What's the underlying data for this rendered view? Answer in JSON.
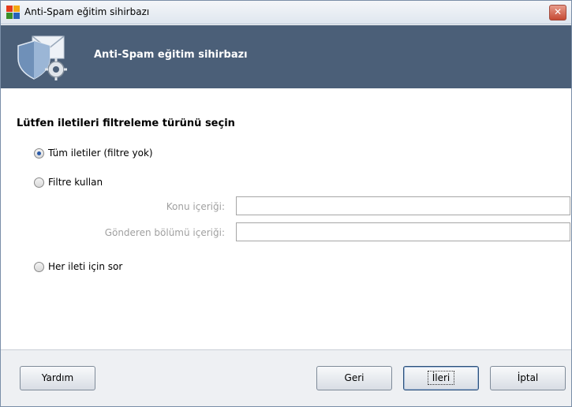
{
  "window": {
    "title": "Anti-Spam eğitim sihirbazı",
    "close_label": "✕"
  },
  "banner": {
    "title": "Anti-Spam eğitim sihirbazı"
  },
  "form": {
    "prompt": "Lütfen iletileri filtreleme türünü seçin",
    "options": [
      {
        "label": "Tüm iletiler (filtre yok)",
        "checked": true
      },
      {
        "label": "Filtre kullan",
        "checked": false
      },
      {
        "label": "Her ileti için sor",
        "checked": false
      }
    ],
    "fields": [
      {
        "label": "Konu içeriği:",
        "value": ""
      },
      {
        "label": "Gönderen bölümü içeriği:",
        "value": ""
      }
    ]
  },
  "footer": {
    "help_label": "Yardım",
    "back_label": "Geri",
    "next_label": "İleri",
    "cancel_label": "İptal"
  },
  "colors": {
    "banner_bg": "#4b5f78",
    "radio_accent": "#2a5aa8"
  }
}
